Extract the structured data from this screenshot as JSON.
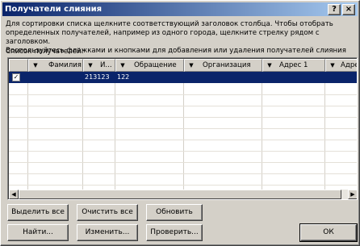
{
  "window": {
    "title": "Получатели слияния",
    "help_label": "?",
    "close_label": "×"
  },
  "instructions": "Для сортировки списка щелкните соответствующий заголовок столбца.  Чтобы отобрать\nопределенных получателей, например из одного города, щелкните стрелку рядом с заголовком.\nВоспользуйтесь флажками и кнопками для добавления или удаления получателей слияния",
  "list_label": "Список получателей:",
  "table": {
    "columns": [
      "",
      "Фамилия",
      "И...",
      "Обращение",
      "Организация",
      "Адрес 1",
      "Адрес"
    ],
    "rows": [
      {
        "checked": "✓",
        "cells": [
          "",
          "",
          "213123",
          "122",
          "",
          "",
          ""
        ]
      }
    ]
  },
  "buttons": {
    "select_all": "Выделить все",
    "clear_all": "Очистить все",
    "refresh": "Обновить",
    "find": "Найти...",
    "edit": "Изменить...",
    "validate": "Проверить...",
    "ok": "ОК"
  }
}
